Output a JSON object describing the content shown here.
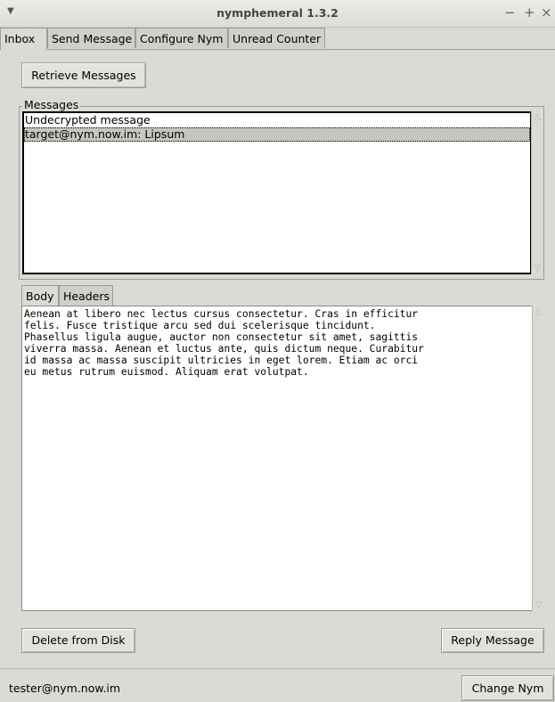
{
  "window": {
    "title": "nymphemeral 1.3.2",
    "menu_icon": "down-arrow-icon",
    "minimize": "−",
    "maximize": "+",
    "close": "×"
  },
  "tabs": [
    {
      "label": "Inbox",
      "active": true
    },
    {
      "label": "Send Message",
      "active": false
    },
    {
      "label": "Configure Nym",
      "active": false
    },
    {
      "label": "Unread Counter",
      "active": false
    }
  ],
  "inbox": {
    "retrieve_button": "Retrieve Messages",
    "messages_group_label": "Messages",
    "messages": [
      {
        "text": "Undecrypted message",
        "selected": false
      },
      {
        "text": "target@nym.now.im: Lipsum",
        "selected": true
      }
    ],
    "detail_tabs": [
      {
        "label": "Body",
        "active": true
      },
      {
        "label": "Headers",
        "active": false
      }
    ],
    "body_text": "Aenean at libero nec lectus cursus consectetur. Cras in efficitur\nfelis. Fusce tristique arcu sed dui scelerisque tincidunt.\nPhasellus ligula augue, auctor non consectetur sit amet, sagittis\nviverra massa. Aenean et luctus ante, quis dictum neque. Curabitur\nid massa ac massa suscipit ultricies in eget lorem. Etiam ac orci\neu metus rutrum euismod. Aliquam erat volutpat.",
    "delete_button": "Delete from Disk",
    "reply_button": "Reply Message"
  },
  "status": {
    "user": "tester@nym.now.im",
    "change_nym_button": "Change Nym"
  }
}
